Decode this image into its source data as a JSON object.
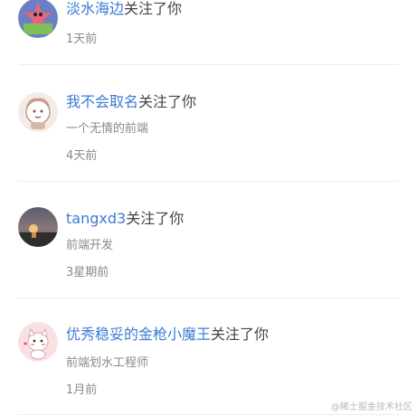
{
  "notifications": [
    {
      "avatar": "starfish-avatar",
      "username": "淡水海边",
      "action": "关注了你",
      "bio": "",
      "time": "1天前"
    },
    {
      "avatar": "cartoon-doll-avatar",
      "username": "我不会取名",
      "action": "关注了你",
      "bio": "一个无情的前端",
      "time": "4天前"
    },
    {
      "avatar": "sunset-photo-avatar",
      "username": "tangxd3",
      "action": "关注了你",
      "bio": "前端开发",
      "time": "3星期前"
    },
    {
      "avatar": "cartoon-cat-avatar",
      "username": "优秀稳妥的金枪小魔王",
      "action": "关注了你",
      "bio": "前端划水工程师",
      "time": "1月前"
    }
  ],
  "watermark": "@稀土掘金技术社区",
  "colors": {
    "username": "#3a7bd5",
    "meta": "#8a8a8a",
    "divider": "#ececec"
  }
}
